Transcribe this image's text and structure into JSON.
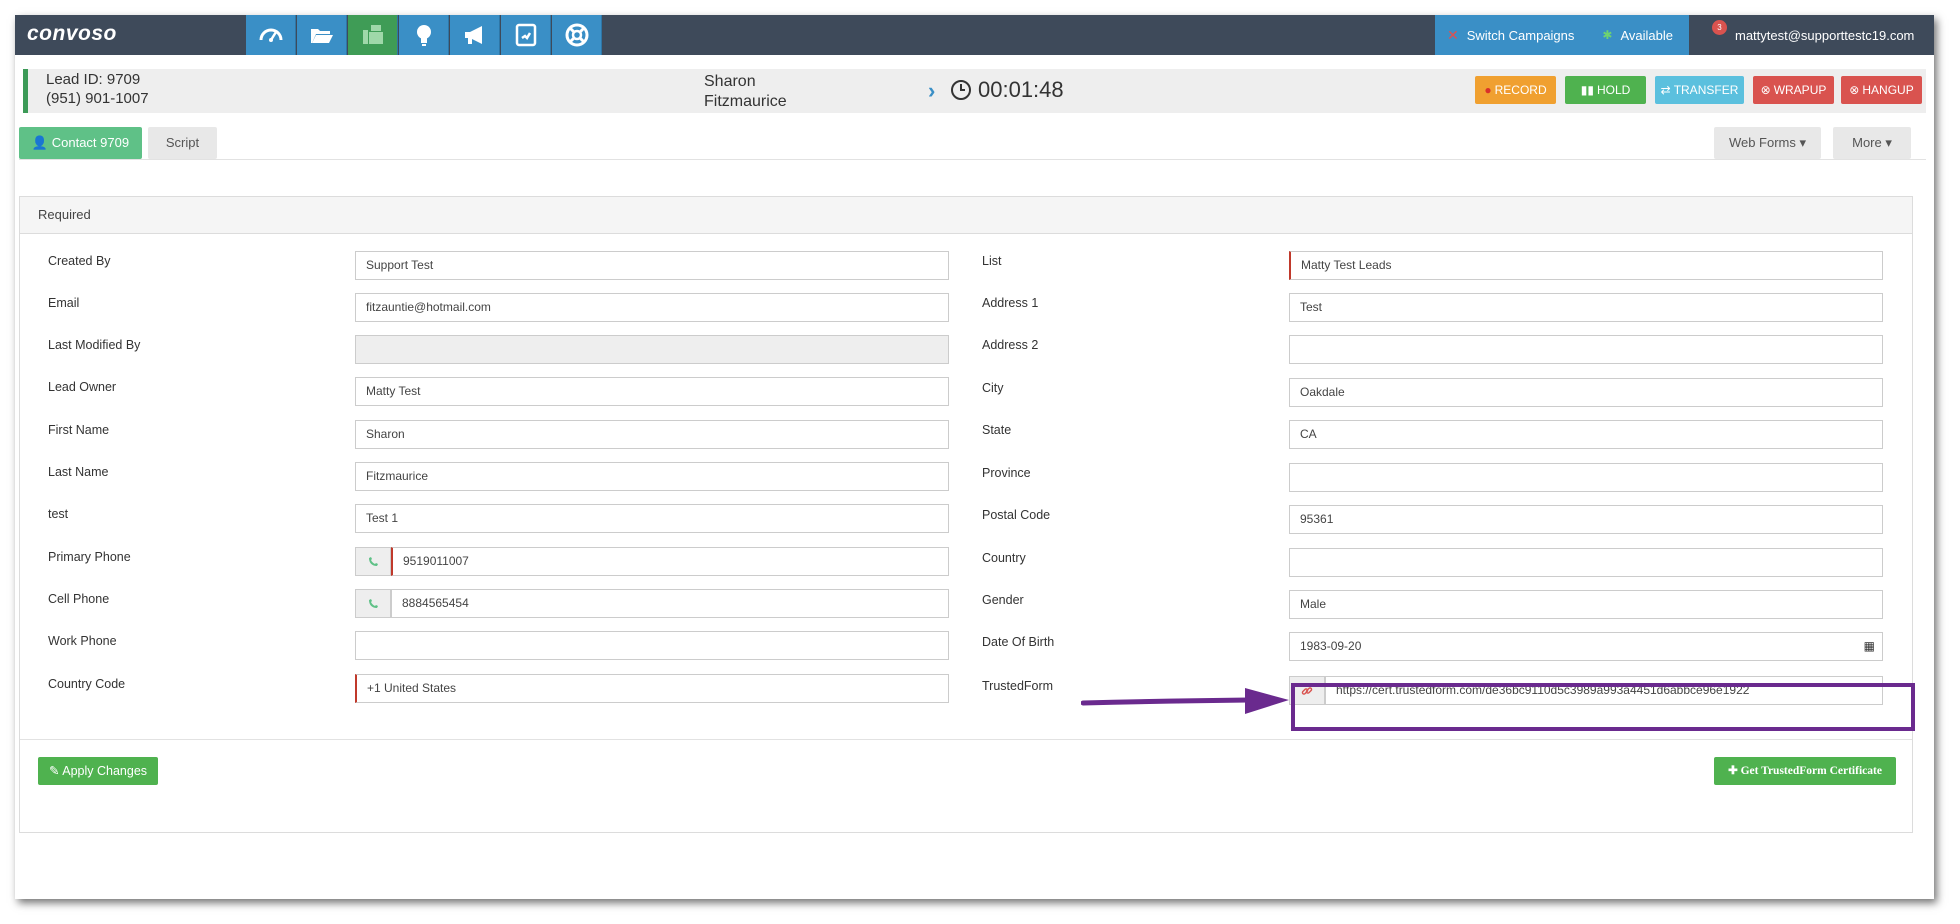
{
  "app": {
    "logo": "convoso"
  },
  "nav": {
    "icons": [
      "dashboard-icon",
      "folder-icon",
      "fax-icon",
      "lightbulb-icon",
      "megaphone-icon",
      "phone-book-icon",
      "lifebuoy-icon"
    ]
  },
  "header": {
    "switch_campaigns": "Switch Campaigns",
    "status": "Available",
    "notifications": "3",
    "user_email": "mattytest@supporttestc19.com"
  },
  "lead": {
    "id_label": "Lead ID: 9709",
    "phone": "(951) 901-1007",
    "first_name": "Sharon",
    "last_name": "Fitzmaurice",
    "timer": "00:01:48"
  },
  "call_buttons": {
    "record": "RECORD",
    "hold": "HOLD",
    "transfer": "TRANSFER",
    "wrapup": "WRAPUP",
    "hangup": "HANGUP"
  },
  "tabs": {
    "contact": "Contact 9709",
    "script": "Script",
    "web_forms": "Web Forms",
    "more": "More"
  },
  "panel": {
    "title": "Required"
  },
  "form_left": {
    "created_by": {
      "label": "Created By",
      "value": "Support Test"
    },
    "email": {
      "label": "Email",
      "value": "fitzauntie@hotmail.com"
    },
    "last_modified_by": {
      "label": "Last Modified By",
      "value": ""
    },
    "lead_owner": {
      "label": "Lead Owner",
      "value": "Matty Test"
    },
    "first_name": {
      "label": "First Name",
      "value": "Sharon"
    },
    "last_name": {
      "label": "Last Name",
      "value": "Fitzmaurice"
    },
    "test": {
      "label": "test",
      "value": "Test 1"
    },
    "primary_phone": {
      "label": "Primary Phone",
      "value": "9519011007"
    },
    "cell_phone": {
      "label": "Cell Phone",
      "value": "8884565454"
    },
    "work_phone": {
      "label": "Work Phone",
      "value": ""
    },
    "country_code": {
      "label": "Country Code",
      "value": "+1 United States"
    }
  },
  "form_right": {
    "list": {
      "label": "List",
      "value": "Matty Test Leads"
    },
    "address1": {
      "label": "Address 1",
      "value": "Test"
    },
    "address2": {
      "label": "Address 2",
      "value": ""
    },
    "city": {
      "label": "City",
      "value": "Oakdale"
    },
    "state": {
      "label": "State",
      "value": "CA"
    },
    "province": {
      "label": "Province",
      "value": ""
    },
    "postal_code": {
      "label": "Postal Code",
      "value": "95361"
    },
    "country": {
      "label": "Country",
      "value": ""
    },
    "gender": {
      "label": "Gender",
      "value": "Male"
    },
    "dob": {
      "label": "Date Of Birth",
      "value": "1983-09-20"
    },
    "trustedform": {
      "label": "TrustedForm",
      "value": "https://cert.trustedform.com/de36bc9110d5c3989a993a4451d6abbce96e1922"
    }
  },
  "footer": {
    "apply": "Apply Changes",
    "get_cert": "Get TrustedForm Certificate"
  },
  "colors": {
    "nav_bg": "#3e4a5a",
    "nav_blue": "#3a8fc6",
    "record": "#f0a030",
    "hold": "#4fb24f",
    "transfer": "#5bc0de",
    "wrapup": "#d9534f",
    "hangup": "#d9534f",
    "highlight": "#6a2a8e"
  }
}
